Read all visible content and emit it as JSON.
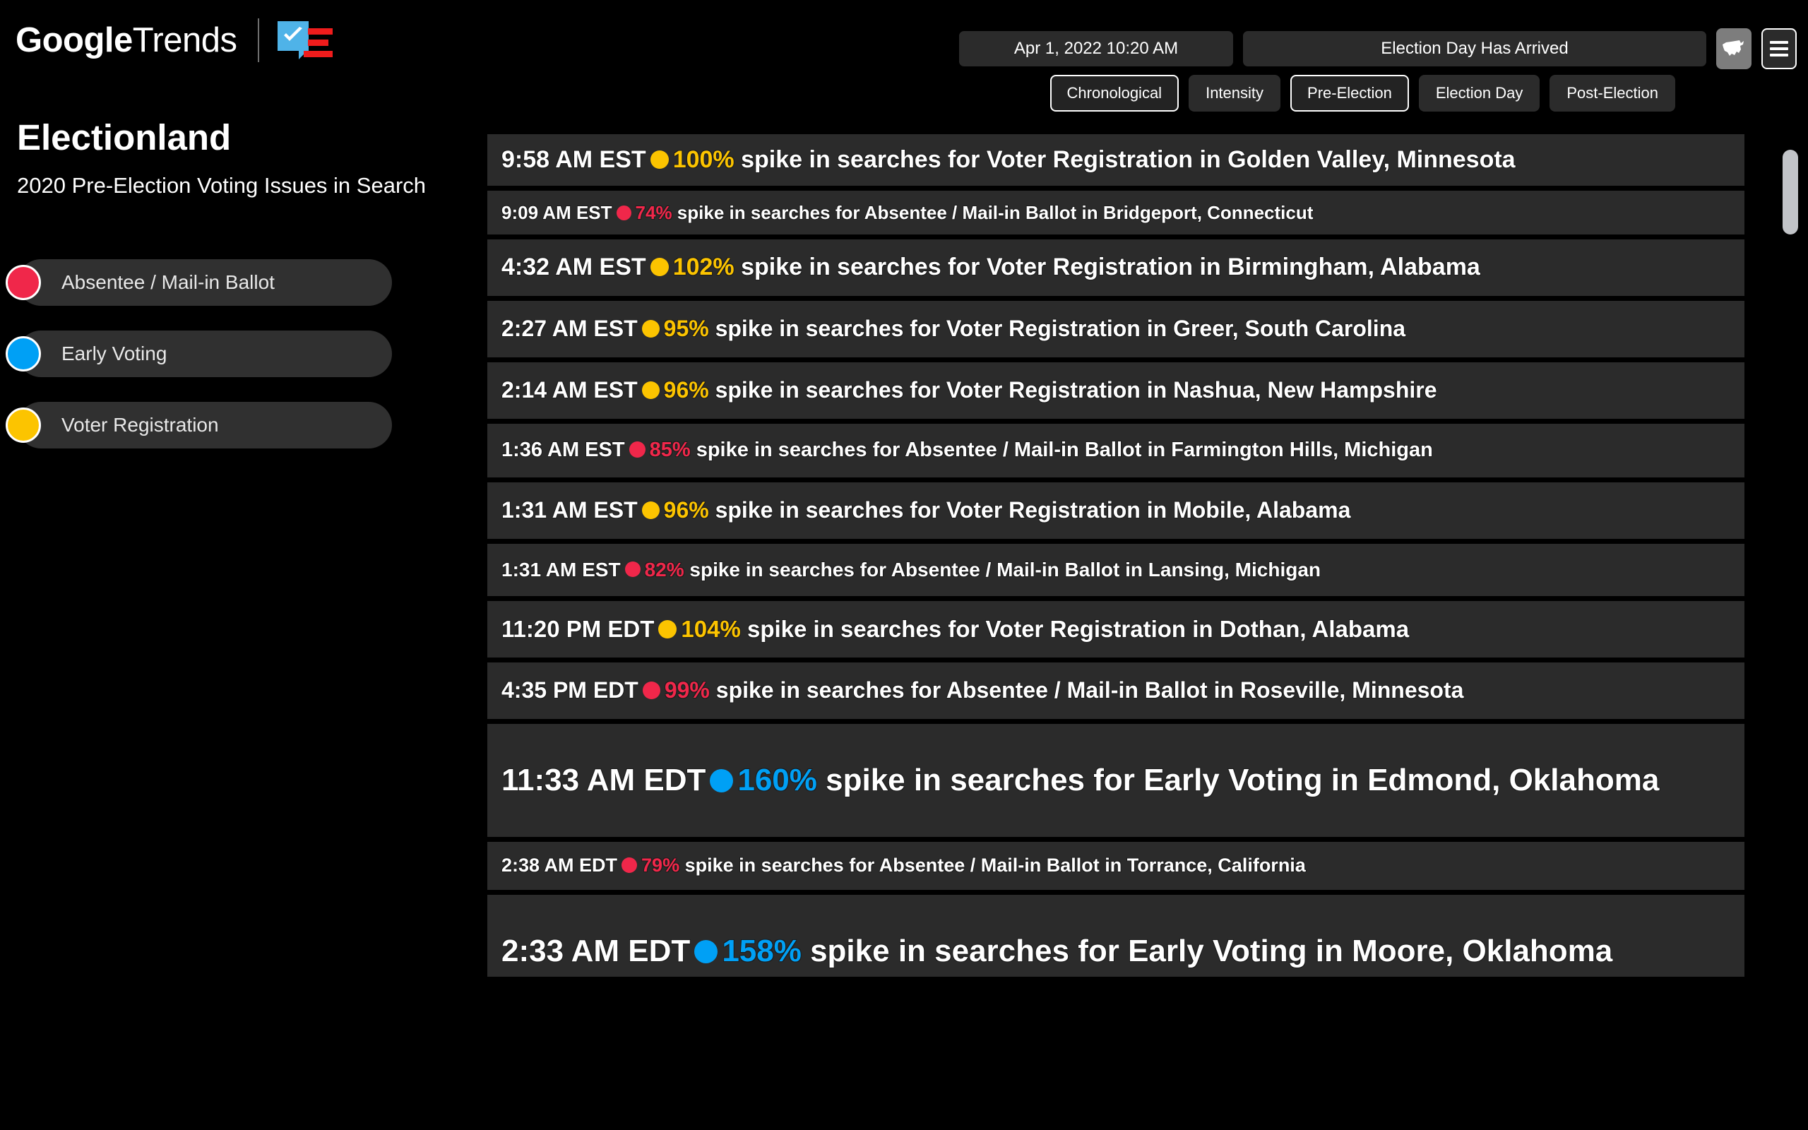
{
  "header": {
    "logo_text_bold": "Google",
    "logo_text_light": "Trends",
    "electionland_icon": "electionland-check-flag-logo",
    "date_button": "Apr 1, 2022 10:20 AM",
    "status_button": "Election Day Has Arrived",
    "map_icon": "us-map-icon",
    "menu_icon": "hamburger-menu-icon",
    "tabs": [
      {
        "label": "Chronological",
        "selected": true
      },
      {
        "label": "Intensity",
        "selected": false
      },
      {
        "label": "Pre-Election",
        "selected": true
      },
      {
        "label": "Election Day",
        "selected": false
      },
      {
        "label": "Post-Election",
        "selected": false
      }
    ]
  },
  "sidebar": {
    "title": "Electionland",
    "subtitle": "2020 Pre-Election Voting Issues in Search",
    "legend": [
      {
        "label": "Absentee / Mail-in Ballot",
        "color": "#F0274A"
      },
      {
        "label": "Early Voting",
        "color": "#00A0F5"
      },
      {
        "label": "Voter Registration",
        "color": "#FCC400"
      }
    ]
  },
  "feed": {
    "rows": [
      {
        "time": "9:58 AM EST",
        "percent": "100%",
        "topic": "Voter Registration",
        "location": "Golden Valley, Minnesota",
        "color": "#FCC400",
        "size": 34,
        "height": 73,
        "dot": 26
      },
      {
        "time": "9:09 AM EST",
        "percent": "74%",
        "topic": "Absentee / Mail-in Ballot",
        "location": "Bridgeport, Connecticut",
        "color": "#F0274A",
        "size": 26,
        "height": 62,
        "dot": 21
      },
      {
        "time": "4:32 AM EST",
        "percent": "102%",
        "topic": "Voter Registration",
        "location": "Birmingham, Alabama",
        "color": "#FCC400",
        "size": 34,
        "height": 80,
        "dot": 26
      },
      {
        "time": "2:27 AM EST",
        "percent": "95%",
        "topic": "Voter Registration",
        "location": "Greer, South Carolina",
        "color": "#FCC400",
        "size": 32,
        "height": 80,
        "dot": 25
      },
      {
        "time": "2:14 AM EST",
        "percent": "96%",
        "topic": "Voter Registration",
        "location": "Nashua, New Hampshire",
        "color": "#FCC400",
        "size": 32,
        "height": 80,
        "dot": 25
      },
      {
        "time": "1:36 AM EST",
        "percent": "85%",
        "topic": "Absentee / Mail-in Ballot",
        "location": "Farmington Hills, Michigan",
        "color": "#F0274A",
        "size": 29,
        "height": 76,
        "dot": 23
      },
      {
        "time": "1:31 AM EST",
        "percent": "96%",
        "topic": "Voter Registration",
        "location": "Mobile, Alabama",
        "color": "#FCC400",
        "size": 32,
        "height": 80,
        "dot": 25
      },
      {
        "time": "1:31 AM EST",
        "percent": "82%",
        "topic": "Absentee / Mail-in Ballot",
        "location": "Lansing, Michigan",
        "color": "#F0274A",
        "size": 28,
        "height": 74,
        "dot": 22
      },
      {
        "time": "11:20 PM EDT",
        "percent": "104%",
        "topic": "Voter Registration",
        "location": "Dothan, Alabama",
        "color": "#FCC400",
        "size": 33,
        "height": 80,
        "dot": 26
      },
      {
        "time": "4:35 PM EDT",
        "percent": "99%",
        "topic": "Absentee / Mail-in Ballot",
        "location": "Roseville, Minnesota",
        "color": "#F0274A",
        "size": 32,
        "height": 80,
        "dot": 25
      },
      {
        "time": "11:33 AM EDT",
        "percent": "160%",
        "topic": "Early Voting",
        "location": "Edmond, Oklahoma",
        "color": "#00A0F5",
        "size": 44,
        "height": 160,
        "dot": 33
      },
      {
        "time": "2:38 AM EDT",
        "percent": "79%",
        "topic": "Absentee / Mail-in Ballot",
        "location": "Torrance, California",
        "color": "#F0274A",
        "size": 27,
        "height": 68,
        "dot": 22
      },
      {
        "time": "2:33 AM EDT",
        "percent": "158%",
        "topic": "Early Voting",
        "location": "Moore, Oklahoma",
        "color": "#00A0F5",
        "size": 44,
        "height": 160,
        "dot": 33
      }
    ],
    "text_before_percent": "",
    "text_mid": "spike in searches for",
    "text_in": "in"
  },
  "scrollbar": {
    "thumb": "vertical-scrollbar-thumb"
  }
}
